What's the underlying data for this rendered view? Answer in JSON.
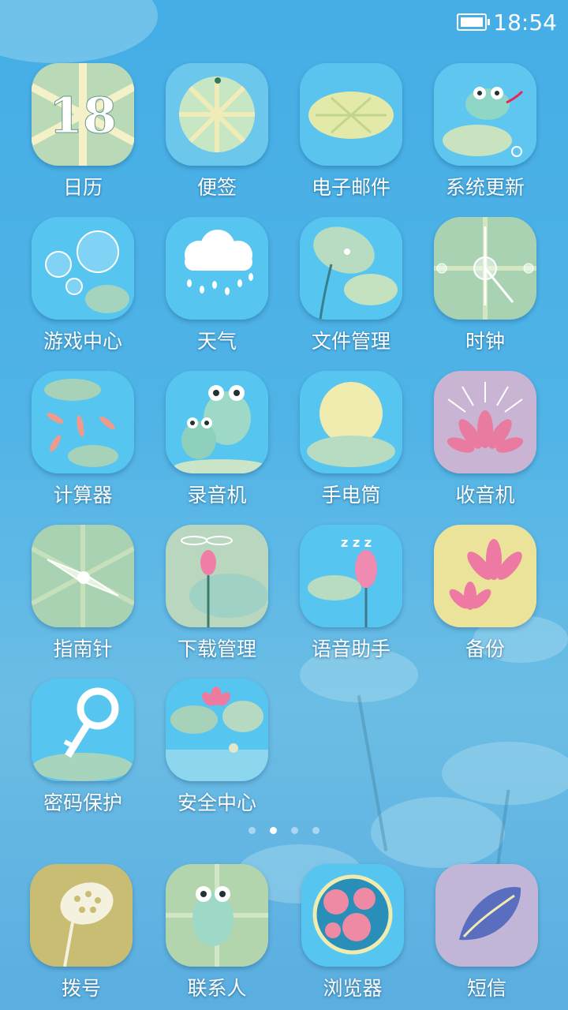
{
  "status_bar": {
    "time": "18:54",
    "battery_icon": "battery-icon"
  },
  "apps": [
    {
      "label": "日历",
      "icon": "calendar-icon",
      "badge": "18",
      "bg": "#b9d9b7"
    },
    {
      "label": "便签",
      "icon": "notes-icon",
      "bg": "#6cc7ec"
    },
    {
      "label": "电子邮件",
      "icon": "email-icon",
      "bg": "#5ac4ef"
    },
    {
      "label": "系统更新",
      "icon": "frog-update-icon",
      "bg": "#5ec6ef"
    },
    {
      "label": "游戏中心",
      "icon": "bubbles-icon",
      "bg": "#56c5f0"
    },
    {
      "label": "天气",
      "icon": "cloud-rain-icon",
      "bg": "#56c5f0"
    },
    {
      "label": "文件管理",
      "icon": "lotus-leaf-icon",
      "bg": "#56c5f0"
    },
    {
      "label": "时钟",
      "icon": "clock-icon",
      "bg": "#a9d2b3"
    },
    {
      "label": "计算器",
      "icon": "koi-fish-icon",
      "bg": "#56c5f0"
    },
    {
      "label": "录音机",
      "icon": "frogs-icon",
      "bg": "#56c5f0"
    },
    {
      "label": "手电筒",
      "icon": "sun-icon",
      "bg": "#56c5f0"
    },
    {
      "label": "收音机",
      "icon": "pink-lotus-icon",
      "bg": "#c9b5d3"
    },
    {
      "label": "指南针",
      "icon": "compass-icon",
      "bg": "#a9d2b3"
    },
    {
      "label": "下载管理",
      "icon": "dragonfly-icon",
      "bg": "#b9d7bf"
    },
    {
      "label": "语音助手",
      "icon": "sleeping-lotus-icon",
      "bg": "#56c5f0"
    },
    {
      "label": "备份",
      "icon": "lotus-flowers-icon",
      "bg": "#ece39a"
    },
    {
      "label": "密码保护",
      "icon": "key-icon",
      "bg": "#56c5f0"
    },
    {
      "label": "安全中心",
      "icon": "pond-icon",
      "bg": "#56c5f0"
    }
  ],
  "page_indicator": {
    "count": 4,
    "active": 1
  },
  "dock": [
    {
      "label": "拨号",
      "icon": "lotus-pod-icon",
      "bg": "#c8bd72"
    },
    {
      "label": "联系人",
      "icon": "frog-contact-icon",
      "bg": "#b3d5ad"
    },
    {
      "label": "浏览器",
      "icon": "globe-icon",
      "bg": "#56c5f0"
    },
    {
      "label": "短信",
      "icon": "petal-icon",
      "bg": "#c2b6d8"
    }
  ]
}
